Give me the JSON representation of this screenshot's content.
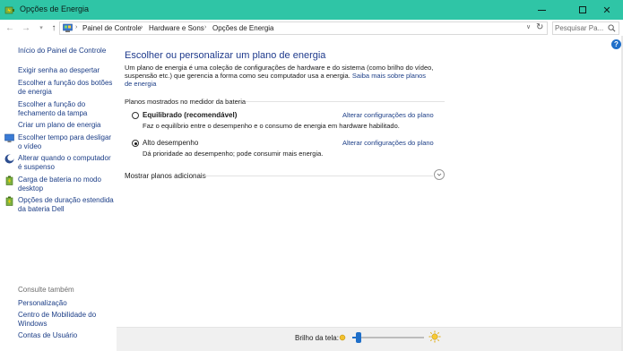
{
  "window": {
    "title": "Opções de Energia",
    "accent_color": "#2fc5a6",
    "controls": {
      "minimize": "minimize-icon",
      "maximize": "maximize-icon",
      "close": "✕"
    }
  },
  "address": {
    "breadcrumbs": [
      "Painel de Controle",
      "Hardware e Sons",
      "Opções de Energia"
    ],
    "search_placeholder": "Pesquisar Pa...",
    "icons": [
      "back-icon",
      "forward-icon",
      "recent-icon",
      "up-icon",
      "control-panel-icon",
      "chevron-down-icon",
      "refresh-icon",
      "search-icon"
    ]
  },
  "sidebar": {
    "home": "Início do Painel de Controle",
    "links": [
      "Exigir senha ao despertar",
      "Escolher a função dos botões de energia",
      "Escolher a função do fechamento da tampa",
      "Criar um plano de energia",
      "Escolher tempo para desligar o vídeo",
      "Alterar quando o computador é suspenso",
      "Carga de bateria no modo desktop",
      "Opções de duração estendida da bateria Dell"
    ],
    "see_also_title": "Consulte também",
    "see_also": [
      "Personalização",
      "Centro de Mobilidade do Windows",
      "Contas de Usuário"
    ]
  },
  "main": {
    "heading": "Escolher ou personalizar um plano de energia",
    "intro_text": "Um plano de energia é uma coleção de configurações de hardware e do sistema (como brilho do vídeo, suspensão etc.) que gerencia a forma como seu computador usa a energia.",
    "intro_link": "Saiba mais sobre planos de energia",
    "section_title": "Planos mostrados no medidor da bateria",
    "plans": [
      {
        "name": "Equilibrado (recomendável)",
        "description": "Faz o equilíbrio entre o desempenho e o consumo de energia em hardware habilitado.",
        "link": "Alterar configurações do plano",
        "selected": false
      },
      {
        "name": "Alto desempenho",
        "description": "Dá prioridade ao desempenho; pode consumir mais energia.",
        "link": "Alterar configurações do plano",
        "selected": true
      }
    ],
    "more_plans": "Mostrar planos adicionais",
    "help_label": "?"
  },
  "footer": {
    "brightness_label": "Brilho da tela:",
    "brightness_level": 0.05
  }
}
